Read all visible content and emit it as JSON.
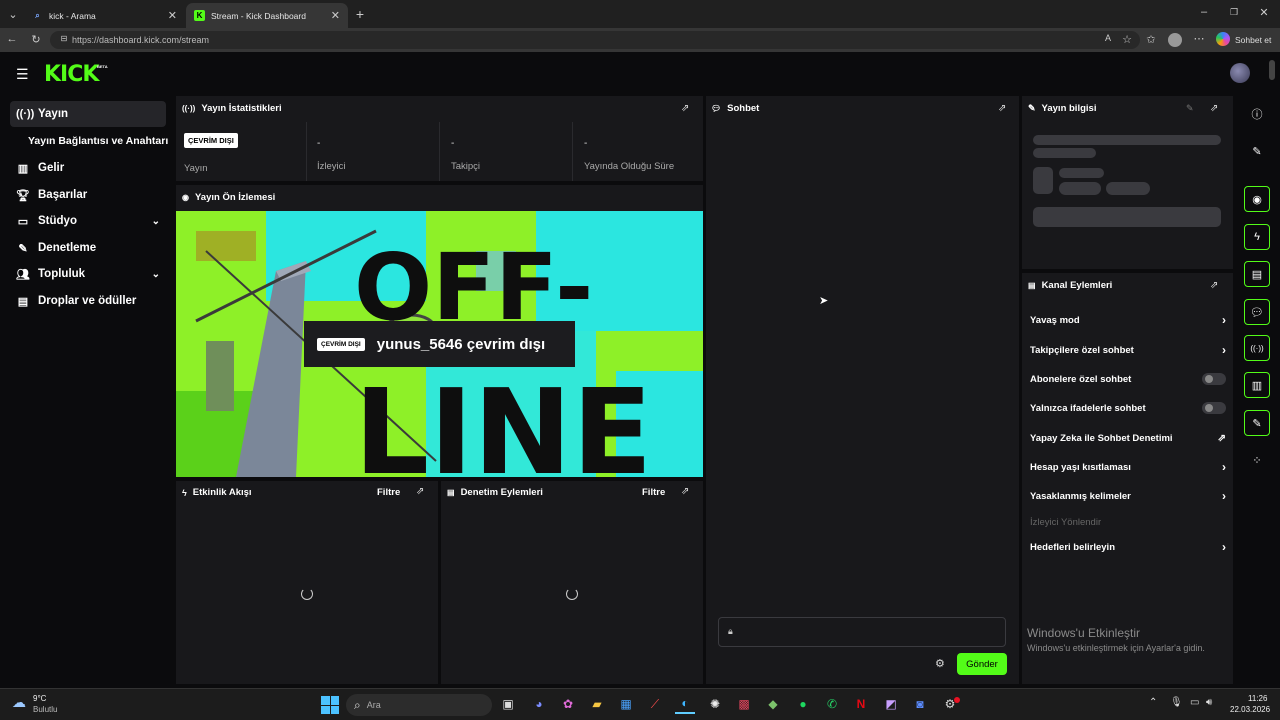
{
  "browser": {
    "tabs": [
      {
        "title": "kick - Arama"
      },
      {
        "title": "Stream - Kick Dashboard"
      }
    ],
    "url": "https://dashboard.kick.com/stream",
    "profile_label": "Sohbet et"
  },
  "brand": {
    "logo": "KICK",
    "badge": "BETA",
    "accent": "#53fc18"
  },
  "sidebar": {
    "items": [
      {
        "label": "Yayın",
        "icon": "broadcast-icon"
      },
      {
        "label": "Yayın Bağlantısı ve Anahtarı"
      },
      {
        "label": "Gelir",
        "icon": "chart-icon"
      },
      {
        "label": "Başarılar",
        "icon": "trophy-icon"
      },
      {
        "label": "Stüdyo",
        "icon": "studio-icon"
      },
      {
        "label": "Denetleme",
        "icon": "wrench-icon"
      },
      {
        "label": "Topluluk",
        "icon": "users-icon"
      },
      {
        "label": "Droplar ve ödüller",
        "icon": "gift-icon"
      }
    ]
  },
  "stats": {
    "title": "Yayın İstatistikleri",
    "status_badge": "ÇEVRİM DIŞI",
    "items": [
      {
        "value": "",
        "label": "Yayın"
      },
      {
        "value": "-",
        "label": "İzleyici"
      },
      {
        "value": "-",
        "label": "Takipçi"
      },
      {
        "value": "-",
        "label": "Yayında Olduğu Süre"
      }
    ]
  },
  "preview": {
    "title": "Yayın Ön İzlemesi",
    "badge": "ÇEVRİM DIŞI",
    "message": "yunus_5646 çevrim dışı",
    "art_text_top": "OFF-",
    "art_text_bottom": "LINE"
  },
  "activity": {
    "title": "Etkinlik Akışı",
    "filter": "Filtre"
  },
  "moderation": {
    "title": "Denetim Eylemleri",
    "filter": "Filtre"
  },
  "chat": {
    "title": "Sohbet",
    "send": "Gönder"
  },
  "stream_info": {
    "title": "Yayın bilgisi"
  },
  "channel_actions": {
    "title": "Kanal Eylemleri",
    "items": [
      {
        "label": "Yavaş mod",
        "control": "arrow"
      },
      {
        "label": "Takipçilere özel sohbet",
        "control": "arrow"
      },
      {
        "label": "Abonelere özel sohbet",
        "control": "toggle",
        "on": false
      },
      {
        "label": "Yalnızca ifadelerle sohbet",
        "control": "toggle",
        "on": false
      },
      {
        "label": "Yapay Zeka ile Sohbet Denetimi",
        "control": "external"
      },
      {
        "label": "Hesap yaşı kısıtlaması",
        "control": "arrow"
      },
      {
        "label": "Yasaklanmış kelimeler",
        "control": "arrow"
      },
      {
        "label": "İzleyici Yönlendir",
        "control": "none",
        "disabled": true
      },
      {
        "label": "Hedefleri belirleyin",
        "control": "arrow"
      }
    ]
  },
  "watermark": {
    "title": "Windows'u Etkinleştir",
    "subtitle": "Windows'u etkinleştirmek için Ayarlar'a gidin."
  },
  "taskbar": {
    "weather_temp": "9°C",
    "weather_desc": "Bulutlu",
    "search_placeholder": "Ara",
    "time": "11:26",
    "date": "22.03.2026"
  }
}
